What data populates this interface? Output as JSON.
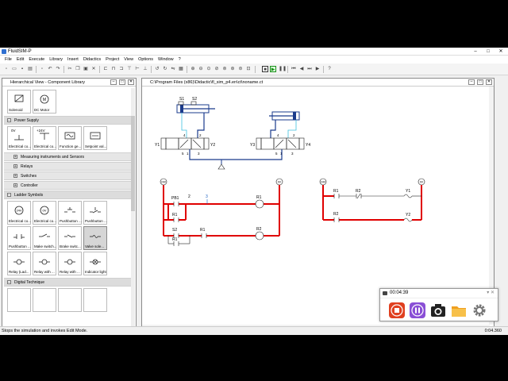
{
  "window": {
    "title": "FluidSIM-P",
    "controls": [
      "–",
      "□",
      "✕"
    ]
  },
  "menu": [
    "File",
    "Edit",
    "Execute",
    "Library",
    "Insert",
    "Didactics",
    "Project",
    "View",
    "Options",
    "Window",
    "?"
  ],
  "library_panel": {
    "title": "Hierarchical View - Component Library",
    "top_items": [
      {
        "label": "Solenoid",
        "icon": "solenoid-icon"
      },
      {
        "label": "DC Motor",
        "icon": "dc-motor-icon"
      }
    ],
    "power_supply": {
      "label": "Power Supply",
      "items": [
        {
          "label": "Electrical co...",
          "icon": "zero-volt-icon",
          "text": "0V"
        },
        {
          "label": "Electrical co...",
          "icon": "plus-24v-icon",
          "text": "+24V"
        },
        {
          "label": "Function ge...",
          "icon": "function-generator-icon"
        },
        {
          "label": "Setpoint val...",
          "icon": "setpoint-value-icon"
        }
      ]
    },
    "subcategories": [
      "Measuring instruments and Sensors",
      "Relays",
      "Switches",
      "Controller"
    ],
    "ladder_symbols": {
      "label": "Ladder Symbols",
      "items": [
        {
          "label": "Electrical co...",
          "icon": "plus-24v-ladder-icon",
          "text": "24V"
        },
        {
          "label": "Electrical co...",
          "icon": "zero-volt-ladder-icon",
          "text": "0V"
        },
        {
          "label": "Pushbutton ...",
          "icon": "pushbutton-no-icon"
        },
        {
          "label": "Pushbutton ...",
          "icon": "pushbutton-nc-icon"
        },
        {
          "label": "Pushbutton ...",
          "icon": "pushbutton-co-icon"
        },
        {
          "label": "Make switch...",
          "icon": "make-switch-icon"
        },
        {
          "label": "Brake switc...",
          "icon": "brake-switch-icon"
        },
        {
          "label": "Valve sole...",
          "icon": "valve-solenoid-icon"
        },
        {
          "label": "Relay (Lad...",
          "icon": "relay-ladder-icon"
        },
        {
          "label": "Relay with ...",
          "icon": "relay-with-icon-1"
        },
        {
          "label": "Relay with ...",
          "icon": "relay-with-icon-2"
        },
        {
          "label": "Indicator light",
          "icon": "indicator-light-icon"
        }
      ]
    },
    "digital": {
      "label": "Digital Technique"
    }
  },
  "document": {
    "title": "C:\\Program Files (x86)\\Didactic\\fl_sim_p4.en\\ct\\noname.ct",
    "pneumatic": {
      "cyl1": {
        "s1": "S1",
        "s2": "S2"
      },
      "valve1": {
        "y1": "Y1",
        "y2": "Y2",
        "p4": "4",
        "p2": "2",
        "p5": "5",
        "p1": "1",
        "p3": "3"
      },
      "valve2": {
        "y3": "Y3",
        "y4": "Y4",
        "p4": "4",
        "p2": "2",
        "p5": "5",
        "p1": "1",
        "p3": "3"
      }
    },
    "ladder1": {
      "left_rail": "24V",
      "right_rail": "0V",
      "pb1": "PB1",
      "r1a": "R1",
      "r1b": "R1",
      "s2": "S2",
      "r1c": "R1",
      "coil1": "R1",
      "coil2": "R2",
      "n2": "2",
      "n3": "3"
    },
    "ladder2": {
      "left_rail": "24V",
      "right_rail": "0V",
      "r1": "R1",
      "r2a": "R2",
      "r2b": "R2",
      "y1": "Y1",
      "y2": "Y2"
    }
  },
  "status": {
    "text": "Stops the simulation and invokes Edit Mode.",
    "time": "0:04.360"
  },
  "recorder": {
    "time": "00:04:39",
    "colors": {
      "stop": "#e04020",
      "pause": "#8a4fd6",
      "folder": "#f0a020",
      "gear": "#777777"
    }
  },
  "colors": {
    "circuit_red": "#e00000",
    "pneumatic_blue": "#1a3b8c",
    "cyan_line": "#40c0e0",
    "sim_green": "#1a8f1a"
  }
}
